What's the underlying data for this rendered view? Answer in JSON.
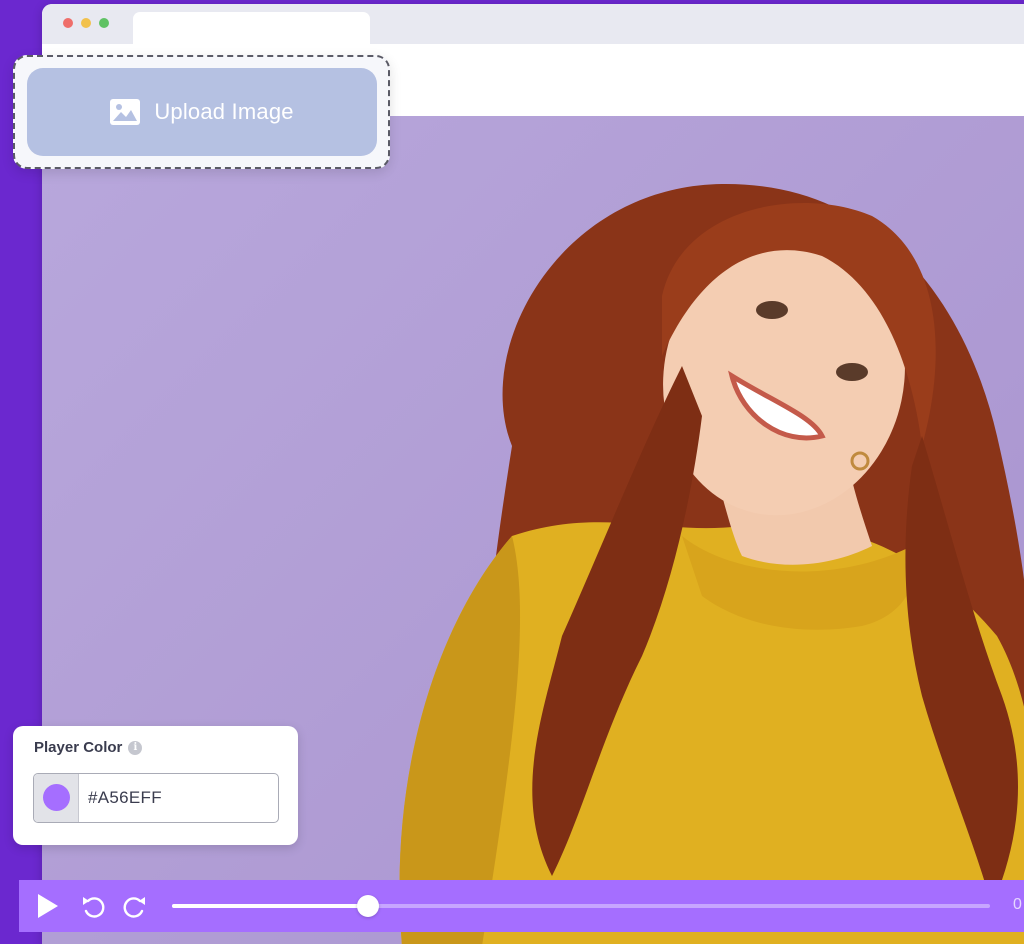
{
  "upload": {
    "label": "Upload Image",
    "icon": "image-icon"
  },
  "player_color": {
    "title": "Player Color",
    "info_icon": "info-icon",
    "hex": "#A56EFF",
    "swatch_color": "#A56EFF"
  },
  "player": {
    "play_icon": "play-icon",
    "rewind_icon": "rewind-icon",
    "forward_icon": "forward-icon",
    "progress_fraction": 0.24,
    "time": "0"
  },
  "colors": {
    "page_background": "#6B28CF",
    "player_bar": "#A56EFF",
    "upload_button": "#B5C1E2"
  }
}
